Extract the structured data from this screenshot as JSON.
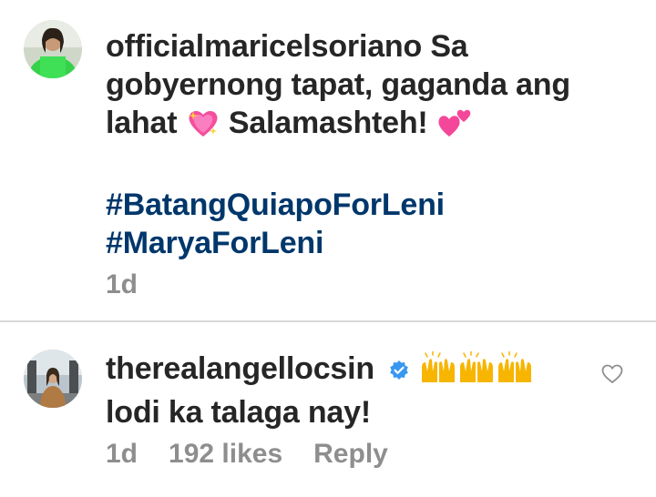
{
  "comments": [
    {
      "username": "officialmaricelsoriano",
      "message_line1": "Sa",
      "message_line2": "gobyernong tapat, gaganda ang",
      "message_line3_a": "lahat",
      "message_line3_b": "Salamashteh!",
      "emoji_1": "sparkling-heart",
      "emoji_2": "two-hearts",
      "hashtags": [
        "#BatangQuiapoForLeni",
        "#MaryaForLeni"
      ],
      "time": "1d"
    },
    {
      "username": "therealangellocsin",
      "verified": true,
      "emoji": "raising-hands x3",
      "message": "lodi ka talaga nay!",
      "time": "1d",
      "likes": "192 likes",
      "reply_label": "Reply"
    }
  ],
  "colors": {
    "hashtag": "#00376b",
    "meta": "#8e8e8e",
    "verified": "#3897f0",
    "text": "#262626"
  }
}
